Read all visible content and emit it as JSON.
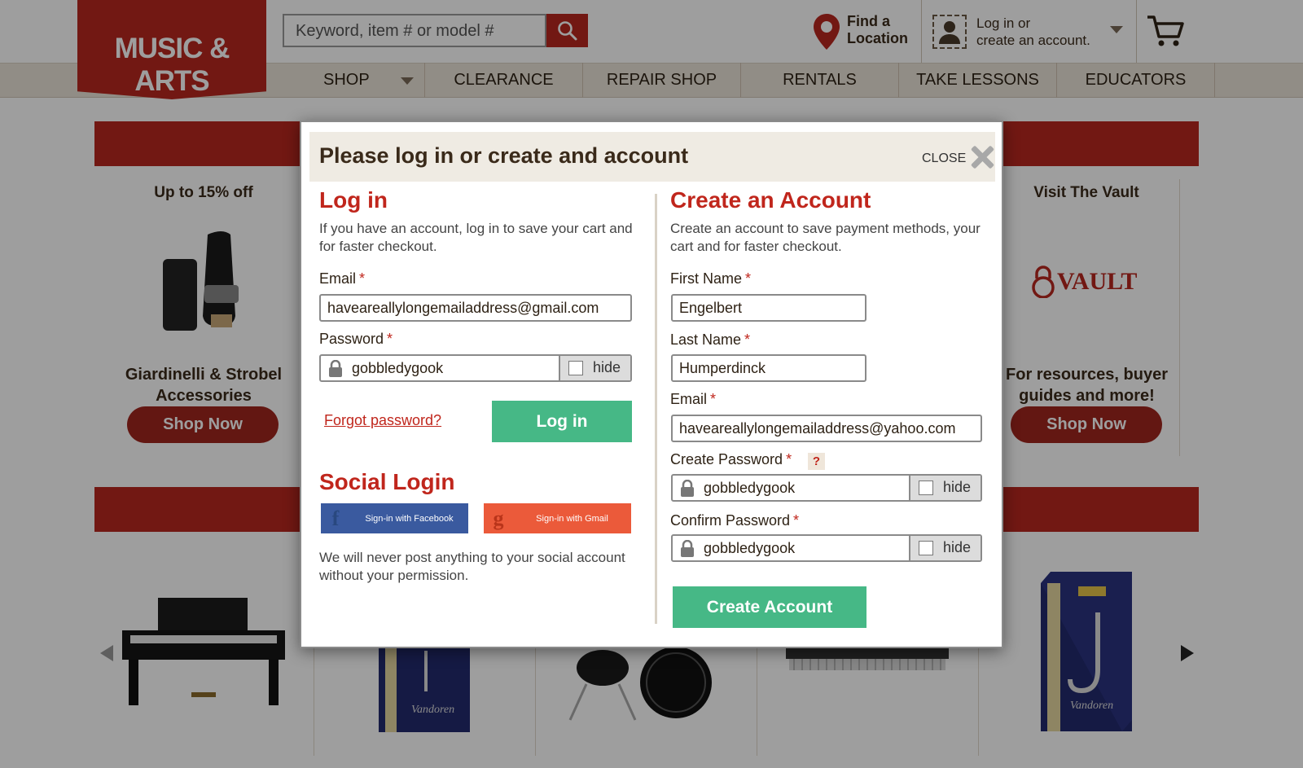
{
  "header": {
    "logo_text": "MUSIC & ARTS",
    "search_placeholder": "Keyword, item # or model #",
    "find_location_line1": "Find a",
    "find_location_line2": "Location",
    "account_line1": "Log in or",
    "account_line2": "create an account."
  },
  "nav": {
    "items": [
      "SHOP",
      "CLEARANCE",
      "REPAIR SHOP",
      "RENTALS",
      "TAKE LESSONS",
      "EDUCATORS"
    ]
  },
  "promos": {
    "left_title": "Up to 15% off",
    "left_name_line1": "Giardinelli & Strobel",
    "left_name_line2": "Accessories",
    "left_button": "Shop Now",
    "right_title": "Visit The Vault",
    "right_logo": "VAULT",
    "right_name_line1": "For resources, buyer",
    "right_name_line2": "guides and more!",
    "right_button": "Shop Now"
  },
  "modal": {
    "title": "Please log in or create and account",
    "close_label": "CLOSE",
    "login": {
      "title": "Log in",
      "description": "If you have an account, log in to save your cart and for faster checkout.",
      "email_label": "Email",
      "email_value": "haveareallylongemailaddress@gmail.com",
      "password_label": "Password",
      "password_value": "gobbledygook",
      "hide_label": "hide",
      "forgot_link": "Forgot password?",
      "login_button": "Log in"
    },
    "social": {
      "title": "Social Login",
      "facebook_label": "Sign-in with Facebook",
      "gmail_label": "Sign-in with Gmail",
      "note": "We will never post anything to your social account without your permission."
    },
    "create": {
      "title": "Create an Account",
      "description": "Create an account to save payment methods, your cart and for faster checkout.",
      "first_name_label": "First Name",
      "first_name_value": "Engelbert",
      "last_name_label": "Last Name",
      "last_name_value": "Humperdinck",
      "email_label": "Email",
      "email_value": "haveareallylongemailaddress@yahoo.com",
      "create_password_label": "Create Password",
      "create_password_value": "gobbledygook",
      "help_mark": "?",
      "confirm_password_label": "Confirm Password",
      "confirm_password_value": "gobbledygook",
      "hide_label": "hide",
      "create_button": "Create Account"
    },
    "required_mark": "*"
  },
  "colors": {
    "brand_red": "#b8271f",
    "accent_green": "#46b886",
    "facebook_blue": "#3a5a9f",
    "gmail_orange": "#eb5a3a"
  }
}
